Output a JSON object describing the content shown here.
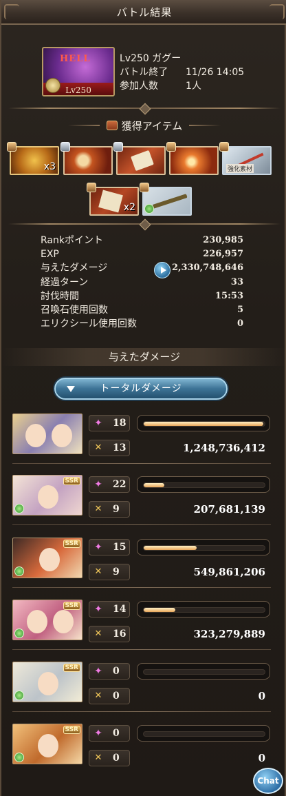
{
  "title": "バトル結果",
  "quest": {
    "thumb_label": "HELL",
    "thumb_level": "Lv250",
    "name": "Lv250 ガグー",
    "end_label": "バトル終了",
    "end_time": "11/26 14:05",
    "participants_label": "参加人数",
    "participants_value": "1人"
  },
  "items_section": {
    "title": "獲得アイテム"
  },
  "items": [
    {
      "icon": "gold-medal-icon",
      "qty": "x3",
      "tag": ""
    },
    {
      "icon": "red-orb-icon",
      "qty": "",
      "tag": ""
    },
    {
      "icon": "scroll-icon",
      "qty": "",
      "tag": ""
    },
    {
      "icon": "fire-orb-icon",
      "qty": "",
      "tag": ""
    },
    {
      "icon": "sword-icon",
      "qty": "",
      "tag": "強化素材"
    },
    {
      "icon": "letter-icon",
      "qty": "x2",
      "tag": ""
    },
    {
      "icon": "gun-icon",
      "qty": "",
      "tag": ""
    }
  ],
  "stats": [
    {
      "label": "Rankポイント",
      "value": "230,985"
    },
    {
      "label": "EXP",
      "value": "226,957"
    },
    {
      "label": "与えたダメージ",
      "value": "2,330,748,646"
    },
    {
      "label": "経過ターン",
      "value": "33"
    },
    {
      "label": "討伐時間",
      "value": "15:53"
    },
    {
      "label": "召喚石使用回数",
      "value": "5"
    },
    {
      "label": "エリクシール使用回数",
      "value": "0"
    }
  ],
  "damage_section": {
    "title": "与えたダメージ"
  },
  "total_button": "トータルダメージ",
  "members": [
    {
      "ability": "18",
      "attack": "13",
      "damage": "1,248,736,412",
      "share": 0.99
    },
    {
      "ability": "22",
      "attack": "9",
      "damage": "207,681,139",
      "share": 0.17
    },
    {
      "ability": "15",
      "attack": "9",
      "damage": "549,861,206",
      "share": 0.44
    },
    {
      "ability": "14",
      "attack": "16",
      "damage": "323,279,889",
      "share": 0.26
    },
    {
      "ability": "0",
      "attack": "0",
      "damage": "0",
      "share": 0
    },
    {
      "ability": "0",
      "attack": "0",
      "damage": "0",
      "share": 0
    }
  ],
  "chat_label": "Chat",
  "colors": {
    "accent": "#3d7396",
    "bar_fill": "#e8a65a",
    "ability_icon": "#f07be4"
  }
}
